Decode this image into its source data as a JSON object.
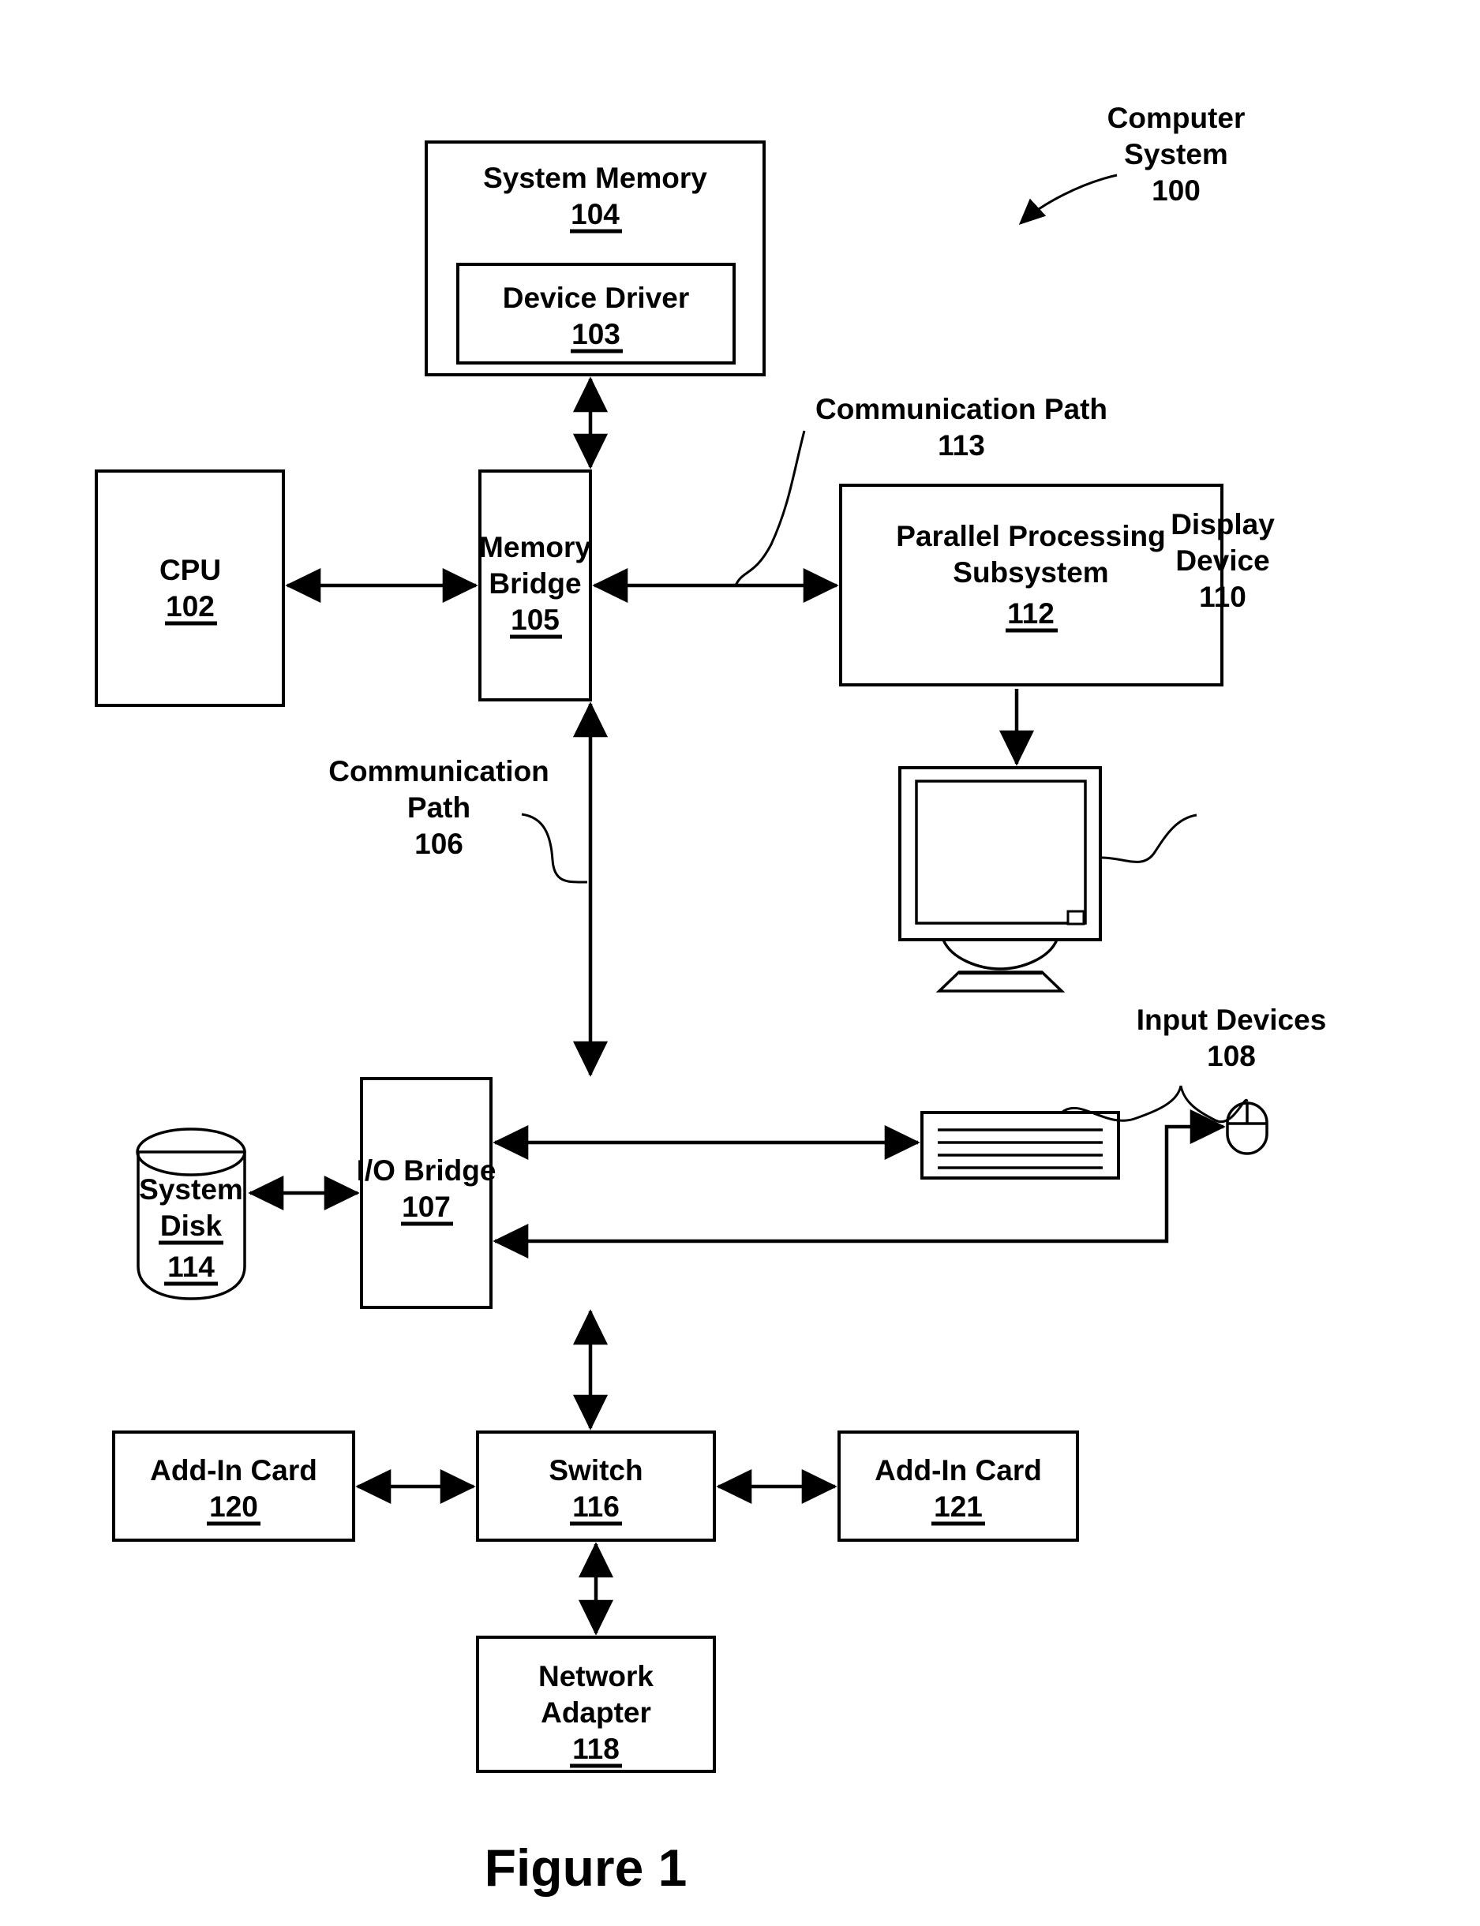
{
  "figure": {
    "caption": "Figure 1",
    "overall_label": {
      "line1": "Computer",
      "line2": "System",
      "ref": "100"
    }
  },
  "blocks": {
    "system_memory": {
      "title": "System Memory",
      "ref": "104"
    },
    "device_driver": {
      "title": "Device Driver",
      "ref": "103"
    },
    "cpu": {
      "title": "CPU",
      "ref": "102"
    },
    "memory_bridge": {
      "title_line1": "Memory",
      "title_line2": "Bridge",
      "ref": "105"
    },
    "parallel_processing_subsystem": {
      "title_line1": "Parallel Processing",
      "title_line2": "Subsystem",
      "ref": "112"
    },
    "io_bridge": {
      "title": "I/O Bridge",
      "ref": "107"
    },
    "system_disk": {
      "title_line1": "System",
      "title_line2": "Disk",
      "ref": "114"
    },
    "add_in_card_left": {
      "title": "Add-In Card",
      "ref": "120"
    },
    "add_in_card_right": {
      "title": "Add-In Card",
      "ref": "121"
    },
    "switch": {
      "title": "Switch",
      "ref": "116"
    },
    "network_adapter": {
      "title_line1": "Network",
      "title_line2": "Adapter",
      "ref": "118"
    }
  },
  "callouts": {
    "communication_path_113": {
      "line1": "Communication Path",
      "ref": "113"
    },
    "communication_path_106": {
      "line1": "Communication",
      "line2": "Path",
      "ref": "106"
    },
    "display_device": {
      "line1": "Display",
      "line2": "Device",
      "ref": "110"
    },
    "input_devices": {
      "line1": "Input Devices",
      "ref": "108"
    }
  },
  "icons": {
    "display": "monitor-icon",
    "keyboard": "keyboard-icon",
    "mouse": "mouse-icon",
    "disk": "cylinder-disk-icon"
  },
  "colors": {
    "stroke": "#000000",
    "fill": "#ffffff"
  }
}
